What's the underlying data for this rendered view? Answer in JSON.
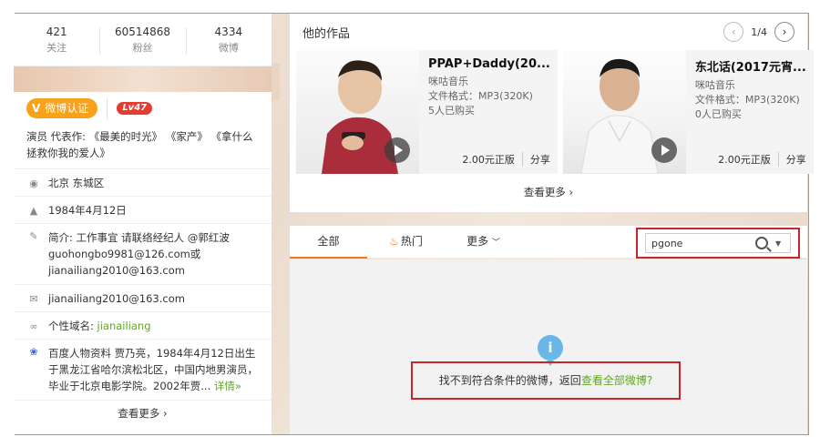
{
  "stats": [
    {
      "num": "421",
      "label": "关注"
    },
    {
      "num": "60514868",
      "label": "粉丝"
    },
    {
      "num": "4334",
      "label": "微博"
    }
  ],
  "profile": {
    "verify_label": "微博认证",
    "level": "Lv47",
    "description": "演员 代表作: 《最美的时光》 《家产》 《拿什么拯救你我的爱人》",
    "location": "北京 东城区",
    "birthday": "1984年4月12日",
    "bio": "简介:  工作事宜 请联络经纪人 @郭红波 guohongbo9981@126.com或jianailiang2010@163.com",
    "email": "jianailiang2010@163.com",
    "domain_label": "个性域名:",
    "domain_value": "jianailiang",
    "baike": "百度人物资料 贾乃亮，1984年4月12日出生于黑龙江省哈尔滨松北区，中国内地男演员，毕业于北京电影学院。2002年贾...",
    "baike_link": "详情»",
    "more": "查看更多 ›"
  },
  "works": {
    "title": "他的作品",
    "page": "1/4",
    "more": "查看更多 ›",
    "items": [
      {
        "title": "PPAP+Daddy(20...",
        "source": "咪咕音乐",
        "format": "文件格式：MP3(320K)",
        "buyers": "5人已购买",
        "price": "2.00元正版",
        "share": "分享"
      },
      {
        "title": "东北话(2017元宵...",
        "source": "咪咕音乐",
        "format": "文件格式：MP3(320K)",
        "buyers": "0人已购买",
        "price": "2.00元正版",
        "share": "分享"
      }
    ]
  },
  "feed": {
    "tabs": {
      "all": "全部",
      "hot": "热门",
      "more": "更多"
    },
    "search_value": "pgone",
    "empty_text": "找不到符合条件的微博，返回",
    "empty_link": "查看全部微博?"
  },
  "colors": {
    "accent": "#f07a22",
    "verify": "#f7a21a",
    "highlight": "#c9252b",
    "link": "#5fa81e"
  }
}
